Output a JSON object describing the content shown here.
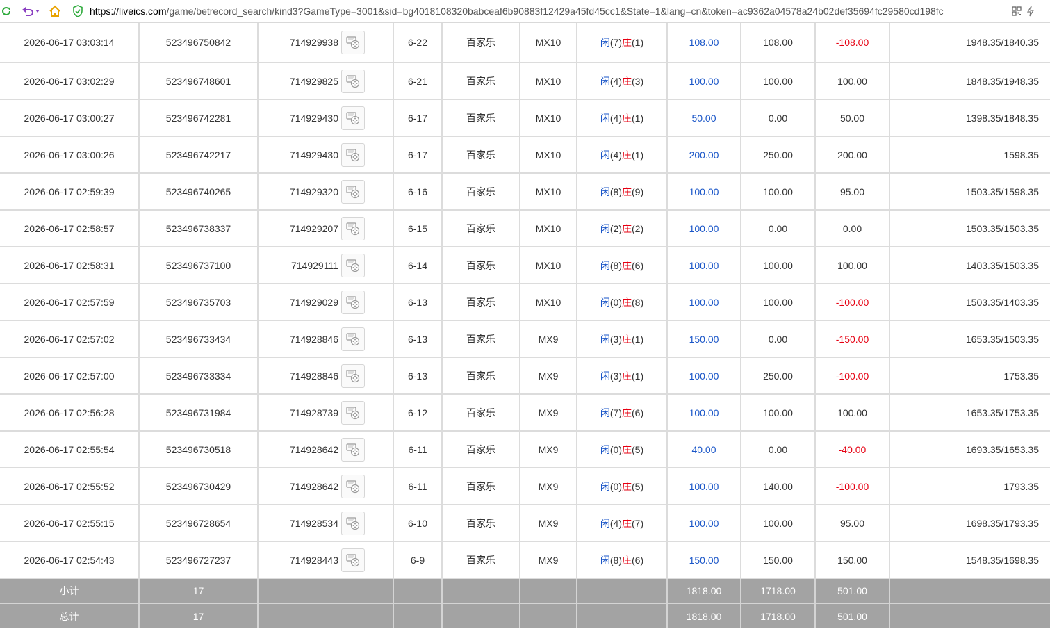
{
  "browser": {
    "url_domain": "https://liveics.com",
    "url_rest": "/game/betrecord_search/kind3?GameType=3001&sid=bg4018108320babceaf6b90883f12429a45fd45cc1&State=1&lang=cn&token=ac9362a04578a24b02def35694fc29580cd198fc"
  },
  "rows": [
    {
      "time": "2026-06-17 03:03:14",
      "bet_id": "523496750842",
      "round_id": "714929938",
      "table_round": "6-22",
      "game": "百家乐",
      "table": "MX10",
      "player_label": "闲",
      "player_score": "(7)",
      "banker_label": "庄",
      "banker_score": "(1)",
      "bet": "108.00",
      "valid": "108.00",
      "win": "-108.00",
      "balance": "1948.35/1840.35"
    },
    {
      "time": "2026-06-17 03:02:29",
      "bet_id": "523496748601",
      "round_id": "714929825",
      "table_round": "6-21",
      "game": "百家乐",
      "table": "MX10",
      "player_label": "闲",
      "player_score": "(4)",
      "banker_label": "庄",
      "banker_score": "(3)",
      "bet": "100.00",
      "valid": "100.00",
      "win": "100.00",
      "balance": "1848.35/1948.35"
    },
    {
      "time": "2026-06-17 03:00:27",
      "bet_id": "523496742281",
      "round_id": "714929430",
      "table_round": "6-17",
      "game": "百家乐",
      "table": "MX10",
      "player_label": "闲",
      "player_score": "(4)",
      "banker_label": "庄",
      "banker_score": "(1)",
      "bet": "50.00",
      "valid": "0.00",
      "win": "50.00",
      "balance": "1398.35/1848.35"
    },
    {
      "time": "2026-06-17 03:00:26",
      "bet_id": "523496742217",
      "round_id": "714929430",
      "table_round": "6-17",
      "game": "百家乐",
      "table": "MX10",
      "player_label": "闲",
      "player_score": "(4)",
      "banker_label": "庄",
      "banker_score": "(1)",
      "bet": "200.00",
      "valid": "250.00",
      "win": "200.00",
      "balance": "1598.35"
    },
    {
      "time": "2026-06-17 02:59:39",
      "bet_id": "523496740265",
      "round_id": "714929320",
      "table_round": "6-16",
      "game": "百家乐",
      "table": "MX10",
      "player_label": "闲",
      "player_score": "(8)",
      "banker_label": "庄",
      "banker_score": "(9)",
      "bet": "100.00",
      "valid": "100.00",
      "win": "95.00",
      "balance": "1503.35/1598.35"
    },
    {
      "time": "2026-06-17 02:58:57",
      "bet_id": "523496738337",
      "round_id": "714929207",
      "table_round": "6-15",
      "game": "百家乐",
      "table": "MX10",
      "player_label": "闲",
      "player_score": "(2)",
      "banker_label": "庄",
      "banker_score": "(2)",
      "bet": "100.00",
      "valid": "0.00",
      "win": "0.00",
      "balance": "1503.35/1503.35"
    },
    {
      "time": "2026-06-17 02:58:31",
      "bet_id": "523496737100",
      "round_id": "714929111",
      "table_round": "6-14",
      "game": "百家乐",
      "table": "MX10",
      "player_label": "闲",
      "player_score": "(8)",
      "banker_label": "庄",
      "banker_score": "(6)",
      "bet": "100.00",
      "valid": "100.00",
      "win": "100.00",
      "balance": "1403.35/1503.35"
    },
    {
      "time": "2026-06-17 02:57:59",
      "bet_id": "523496735703",
      "round_id": "714929029",
      "table_round": "6-13",
      "game": "百家乐",
      "table": "MX10",
      "player_label": "闲",
      "player_score": "(0)",
      "banker_label": "庄",
      "banker_score": "(8)",
      "bet": "100.00",
      "valid": "100.00",
      "win": "-100.00",
      "balance": "1503.35/1403.35"
    },
    {
      "time": "2026-06-17 02:57:02",
      "bet_id": "523496733434",
      "round_id": "714928846",
      "table_round": "6-13",
      "game": "百家乐",
      "table": "MX9",
      "player_label": "闲",
      "player_score": "(3)",
      "banker_label": "庄",
      "banker_score": "(1)",
      "bet": "150.00",
      "valid": "0.00",
      "win": "-150.00",
      "balance": "1653.35/1503.35"
    },
    {
      "time": "2026-06-17 02:57:00",
      "bet_id": "523496733334",
      "round_id": "714928846",
      "table_round": "6-13",
      "game": "百家乐",
      "table": "MX9",
      "player_label": "闲",
      "player_score": "(3)",
      "banker_label": "庄",
      "banker_score": "(1)",
      "bet": "100.00",
      "valid": "250.00",
      "win": "-100.00",
      "balance": "1753.35"
    },
    {
      "time": "2026-06-17 02:56:28",
      "bet_id": "523496731984",
      "round_id": "714928739",
      "table_round": "6-12",
      "game": "百家乐",
      "table": "MX9",
      "player_label": "闲",
      "player_score": "(7)",
      "banker_label": "庄",
      "banker_score": "(6)",
      "bet": "100.00",
      "valid": "100.00",
      "win": "100.00",
      "balance": "1653.35/1753.35"
    },
    {
      "time": "2026-06-17 02:55:54",
      "bet_id": "523496730518",
      "round_id": "714928642",
      "table_round": "6-11",
      "game": "百家乐",
      "table": "MX9",
      "player_label": "闲",
      "player_score": "(0)",
      "banker_label": "庄",
      "banker_score": "(5)",
      "bet": "40.00",
      "valid": "0.00",
      "win": "-40.00",
      "balance": "1693.35/1653.35"
    },
    {
      "time": "2026-06-17 02:55:52",
      "bet_id": "523496730429",
      "round_id": "714928642",
      "table_round": "6-11",
      "game": "百家乐",
      "table": "MX9",
      "player_label": "闲",
      "player_score": "(0)",
      "banker_label": "庄",
      "banker_score": "(5)",
      "bet": "100.00",
      "valid": "140.00",
      "win": "-100.00",
      "balance": "1793.35"
    },
    {
      "time": "2026-06-17 02:55:15",
      "bet_id": "523496728654",
      "round_id": "714928534",
      "table_round": "6-10",
      "game": "百家乐",
      "table": "MX9",
      "player_label": "闲",
      "player_score": "(4)",
      "banker_label": "庄",
      "banker_score": "(7)",
      "bet": "100.00",
      "valid": "100.00",
      "win": "95.00",
      "balance": "1698.35/1793.35"
    },
    {
      "time": "2026-06-17 02:54:43",
      "bet_id": "523496727237",
      "round_id": "714928443",
      "table_round": "6-9",
      "game": "百家乐",
      "table": "MX9",
      "player_label": "闲",
      "player_score": "(8)",
      "banker_label": "庄",
      "banker_score": "(6)",
      "bet": "150.00",
      "valid": "150.00",
      "win": "150.00",
      "balance": "1548.35/1698.35"
    }
  ],
  "subtotal": {
    "label": "小计",
    "count": "17",
    "bet": "1818.00",
    "valid": "1718.00",
    "win": "501.00"
  },
  "total": {
    "label": "总计",
    "count": "17",
    "bet": "1818.00",
    "valid": "1718.00",
    "win": "501.00"
  },
  "colors": {
    "link_blue": "#1a56c8",
    "loss_red": "#e60012",
    "summary_bg": "#a3a3a3"
  },
  "icons": {
    "reload": "reload-icon",
    "undo": "undo-icon",
    "home": "home-icon",
    "shield": "shield-check-icon",
    "qr": "qr-code-icon",
    "bolt": "lightning-icon",
    "video": "video-replay-icon"
  }
}
